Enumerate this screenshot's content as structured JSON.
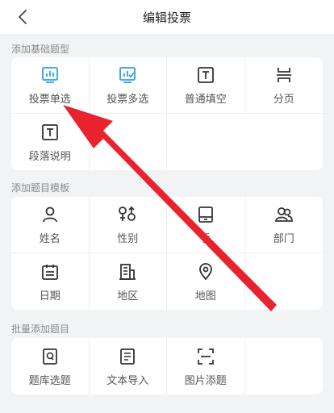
{
  "header": {
    "title": "编辑投票"
  },
  "sections": [
    {
      "title": "添加基础题型",
      "items": [
        {
          "label": "投票单选",
          "icon": "poll-single-icon",
          "color": "#2aa3e0"
        },
        {
          "label": "投票多选",
          "icon": "poll-multi-icon",
          "color": "#2aa3e0"
        },
        {
          "label": "普通填空",
          "icon": "text-box-icon",
          "color": "#333333"
        },
        {
          "label": "分页",
          "icon": "page-break-icon",
          "color": "#333333"
        },
        {
          "label": "段落说明",
          "icon": "paragraph-icon",
          "color": "#333333"
        }
      ]
    },
    {
      "title": "添加题目模板",
      "items": [
        {
          "label": "姓名",
          "icon": "person-icon"
        },
        {
          "label": "性别",
          "icon": "gender-icon"
        },
        {
          "label": "手",
          "icon": "phone-icon"
        },
        {
          "label": "部门",
          "icon": "group-icon"
        },
        {
          "label": "日期",
          "icon": "calendar-icon"
        },
        {
          "label": "地区",
          "icon": "building-icon"
        },
        {
          "label": "地图",
          "icon": "location-pin-icon"
        }
      ]
    },
    {
      "title": "批量添加题目",
      "items": [
        {
          "label": "题库选题",
          "icon": "question-bank-icon"
        },
        {
          "label": "文本导入",
          "icon": "document-icon"
        },
        {
          "label": "图片添题",
          "icon": "scan-icon"
        }
      ]
    }
  ],
  "colors": {
    "accent": "#2aa3e0",
    "annotation_arrow": "#e8232d"
  }
}
